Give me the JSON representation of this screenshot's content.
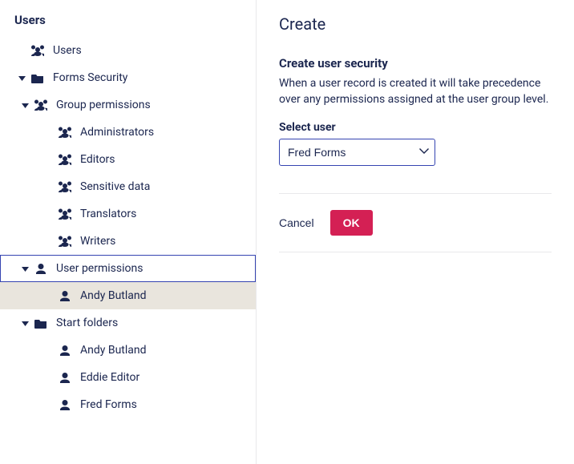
{
  "sidebar": {
    "title": "Users",
    "items": [
      {
        "label": "Users",
        "icon": "users",
        "caret": null,
        "level": 0
      },
      {
        "label": "Forms Security",
        "icon": "folder",
        "caret": "down",
        "level": 0
      },
      {
        "label": "Group permissions",
        "icon": "users",
        "caret": "down",
        "level": 1
      },
      {
        "label": "Administrators",
        "icon": "users",
        "caret": null,
        "level": 2
      },
      {
        "label": "Editors",
        "icon": "users",
        "caret": null,
        "level": 2
      },
      {
        "label": "Sensitive data",
        "icon": "users",
        "caret": null,
        "level": 2
      },
      {
        "label": "Translators",
        "icon": "users",
        "caret": null,
        "level": 2
      },
      {
        "label": "Writers",
        "icon": "users",
        "caret": null,
        "level": 2
      },
      {
        "label": "User permissions",
        "icon": "user",
        "caret": "down",
        "level": 1,
        "outlined": true
      },
      {
        "label": "Andy Butland",
        "icon": "user",
        "caret": null,
        "level": 2,
        "selected": true
      },
      {
        "label": "Start folders",
        "icon": "folder",
        "caret": "down",
        "level": 1
      },
      {
        "label": "Andy Butland",
        "icon": "user",
        "caret": null,
        "level": 2
      },
      {
        "label": "Eddie Editor",
        "icon": "user",
        "caret": null,
        "level": 2
      },
      {
        "label": "Fred Forms",
        "icon": "user",
        "caret": null,
        "level": 2
      }
    ]
  },
  "main": {
    "heading": "Create",
    "section_title": "Create user security",
    "section_desc": "When a user record is created it will take precedence over any permissions assigned at the user group level.",
    "select_label": "Select user",
    "select_value": "Fred Forms",
    "select_options": [
      "Fred Forms"
    ],
    "cancel_label": "Cancel",
    "ok_label": "OK"
  }
}
